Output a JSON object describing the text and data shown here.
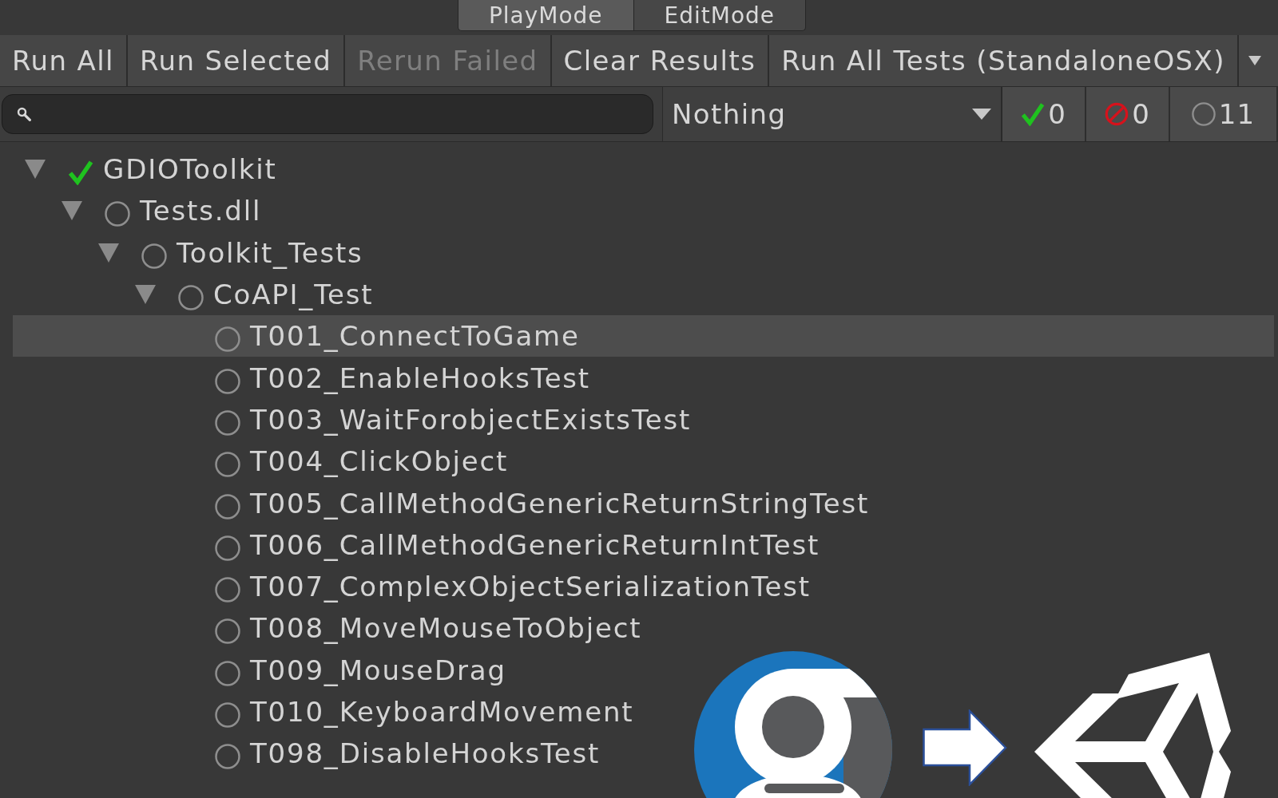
{
  "mode_tabs": [
    {
      "label": "PlayMode",
      "selected": true
    },
    {
      "label": "EditMode",
      "selected": false
    }
  ],
  "toolbar": [
    {
      "label": "Run All",
      "disabled": false
    },
    {
      "label": "Run Selected",
      "disabled": false
    },
    {
      "label": "Rerun Failed",
      "disabled": true
    },
    {
      "label": "Clear Results",
      "disabled": false
    },
    {
      "label": "Run All Tests (StandaloneOSX)",
      "disabled": false
    }
  ],
  "filter": {
    "category": "Nothing"
  },
  "counters": [
    {
      "kind": "passed",
      "count": "0"
    },
    {
      "kind": "failed",
      "count": "0"
    },
    {
      "kind": "untested",
      "count": "11"
    }
  ],
  "tree": [
    {
      "label": "GDIOToolkit",
      "kind": "passed",
      "expanded": true,
      "selected": false,
      "children": [
        {
          "label": "Tests.dll",
          "kind": "untested",
          "expanded": true,
          "selected": false,
          "children": [
            {
              "label": "Toolkit_Tests",
              "kind": "untested",
              "expanded": true,
              "selected": false,
              "children": [
                {
                  "label": "CoAPI_Test",
                  "kind": "untested",
                  "expanded": true,
                  "selected": false,
                  "children": [
                    {
                      "label": "T001_ConnectToGame",
                      "kind": "untested",
                      "selected": true
                    },
                    {
                      "label": "T002_EnableHooksTest",
                      "kind": "untested",
                      "selected": false
                    },
                    {
                      "label": "T003_WaitForobjectExistsTest",
                      "kind": "untested",
                      "selected": false
                    },
                    {
                      "label": "T004_ClickObject",
                      "kind": "untested",
                      "selected": false
                    },
                    {
                      "label": "T005_CallMethodGenericReturnStringTest",
                      "kind": "untested",
                      "selected": false
                    },
                    {
                      "label": "T006_CallMethodGenericReturnIntTest",
                      "kind": "untested",
                      "selected": false
                    },
                    {
                      "label": "T007_ComplexObjectSerializationTest",
                      "kind": "untested",
                      "selected": false
                    },
                    {
                      "label": "T008_MoveMouseToObject",
                      "kind": "untested",
                      "selected": false
                    },
                    {
                      "label": "T009_MouseDrag",
                      "kind": "untested",
                      "selected": false
                    },
                    {
                      "label": "T010_KeyboardMovement",
                      "kind": "untested",
                      "selected": false
                    },
                    {
                      "label": "T098_DisableHooksTest",
                      "kind": "untested",
                      "selected": false
                    }
                  ]
                }
              ]
            }
          ]
        }
      ]
    }
  ]
}
